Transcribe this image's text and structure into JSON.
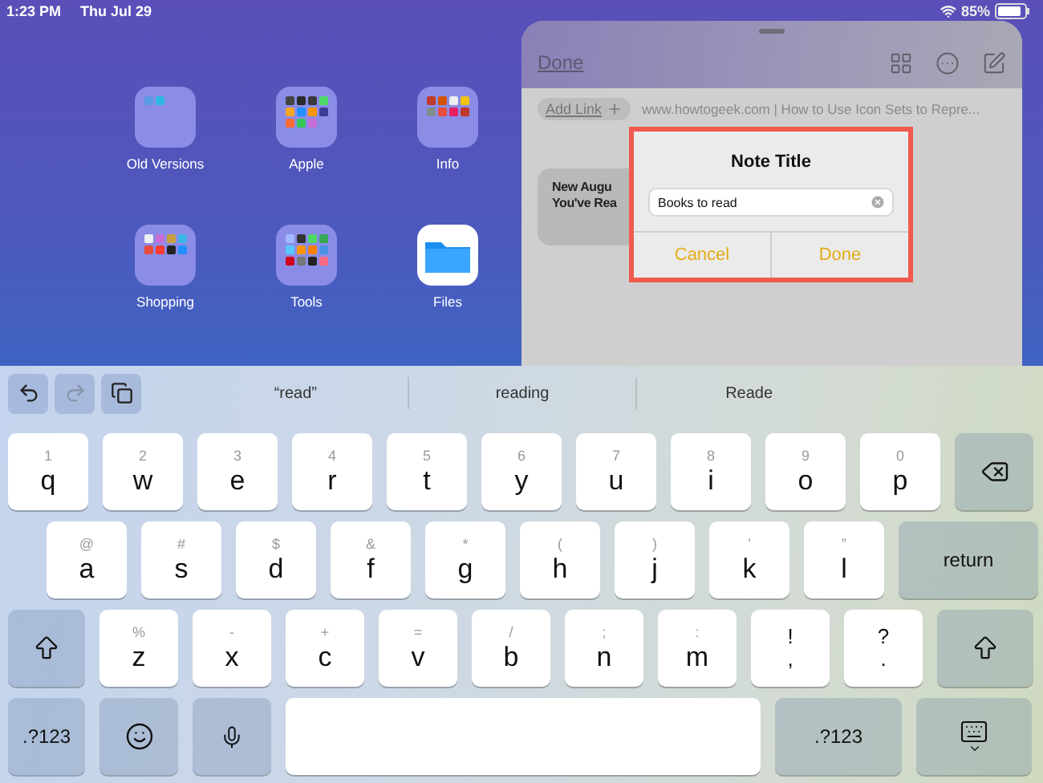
{
  "status_bar": {
    "time": "1:23 PM",
    "date": "Thu Jul 29",
    "battery": "85%"
  },
  "home_screen": {
    "items": [
      {
        "label": "Old Versions",
        "kind": "folder"
      },
      {
        "label": "Apple",
        "kind": "folder"
      },
      {
        "label": "Info",
        "kind": "folder"
      },
      {
        "label": "Shopping",
        "kind": "folder"
      },
      {
        "label": "Tools",
        "kind": "folder"
      },
      {
        "label": "Files",
        "kind": "app"
      }
    ]
  },
  "sheet": {
    "done_label": "Done",
    "add_link_label": "Add Link",
    "url": "www.howtogeek.com | How to Use Icon Sets to Repre...",
    "card_lines": [
      "New Augu",
      "You've Rea"
    ]
  },
  "dialog": {
    "title": "Note Title",
    "field": {
      "value": "Books to read"
    },
    "buttons": [
      "Cancel",
      "Done"
    ]
  },
  "keyboard": {
    "undo": {
      "disabled": false
    },
    "redo": {
      "disabled": true
    },
    "suggestions": [
      "“read”",
      "reading",
      "Reade"
    ],
    "rows": [
      [
        {
          "kind": "letter",
          "label": "q",
          "alt": "1"
        },
        {
          "kind": "letter",
          "label": "w",
          "alt": "2"
        },
        {
          "kind": "letter",
          "label": "e",
          "alt": "3"
        },
        {
          "kind": "letter",
          "label": "r",
          "alt": "4"
        },
        {
          "kind": "letter",
          "label": "t",
          "alt": "5"
        },
        {
          "kind": "letter",
          "label": "y",
          "alt": "6"
        },
        {
          "kind": "letter",
          "label": "u",
          "alt": "7"
        },
        {
          "kind": "letter",
          "label": "i",
          "alt": "8"
        },
        {
          "kind": "letter",
          "label": "o",
          "alt": "9"
        },
        {
          "kind": "letter",
          "label": "p",
          "alt": "0"
        },
        {
          "kind": "delete"
        }
      ],
      [
        {
          "kind": "letter",
          "label": "a",
          "alt": "@"
        },
        {
          "kind": "letter",
          "label": "s",
          "alt": "#"
        },
        {
          "kind": "letter",
          "label": "d",
          "alt": "$"
        },
        {
          "kind": "letter",
          "label": "f",
          "alt": "&"
        },
        {
          "kind": "letter",
          "label": "g",
          "alt": "*"
        },
        {
          "kind": "letter",
          "label": "h",
          "alt": "("
        },
        {
          "kind": "letter",
          "label": "j",
          "alt": ")"
        },
        {
          "kind": "letter",
          "label": "k",
          "alt": "’"
        },
        {
          "kind": "letter",
          "label": "l",
          "alt": "”"
        },
        {
          "kind": "return",
          "label": "return"
        }
      ],
      [
        {
          "kind": "shift"
        },
        {
          "kind": "letter",
          "label": "z",
          "alt": "%"
        },
        {
          "kind": "letter",
          "label": "x",
          "alt": "-"
        },
        {
          "kind": "letter",
          "label": "c",
          "alt": "+"
        },
        {
          "kind": "letter",
          "label": "v",
          "alt": "="
        },
        {
          "kind": "letter",
          "label": "b",
          "alt": "/"
        },
        {
          "kind": "letter",
          "label": "n",
          "alt": ";"
        },
        {
          "kind": "letter",
          "label": "m",
          "alt": ":"
        },
        {
          "kind": "punct",
          "top": "!",
          "bottom": ","
        },
        {
          "kind": "punct",
          "top": "?",
          "bottom": "."
        },
        {
          "kind": "shift"
        }
      ],
      [
        {
          "kind": "numbers",
          "label": ".?123"
        },
        {
          "kind": "emoji"
        },
        {
          "kind": "mic"
        },
        {
          "kind": "space"
        },
        {
          "kind": "numbers",
          "label": ".?123"
        },
        {
          "kind": "dismiss"
        }
      ]
    ]
  }
}
